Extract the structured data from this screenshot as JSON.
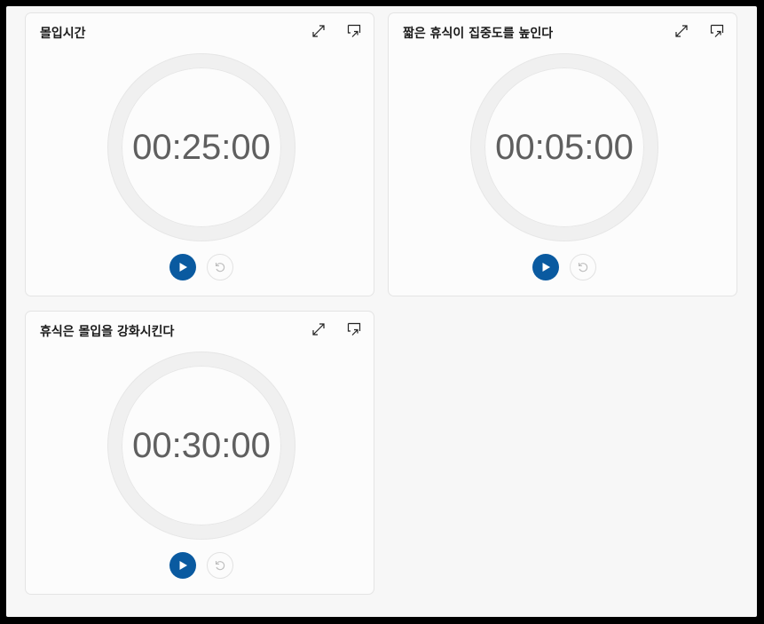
{
  "timers": [
    {
      "title": "몰입시간",
      "time": "00:25:00"
    },
    {
      "title": "짧은 휴식이 집중도를 높인다",
      "time": "00:05:00"
    },
    {
      "title": "휴식은 몰입을 강화시킨다",
      "time": "00:30:00"
    }
  ],
  "icons": {
    "expand": "expand-icon",
    "pin": "pin-icon",
    "play": "play-icon",
    "reset": "reset-icon"
  },
  "colors": {
    "accent": "#0a5aa0",
    "ring": "#f0f0f0",
    "time_text": "#5f5f5f",
    "card_bg": "#fcfcfc",
    "window_bg": "#f7f7f7"
  }
}
